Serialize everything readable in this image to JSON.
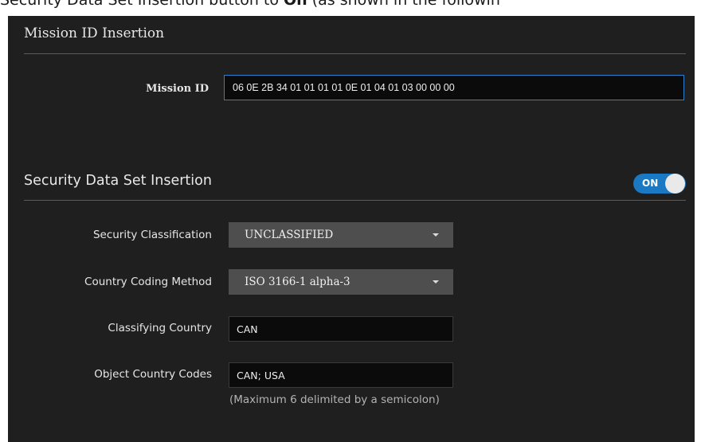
{
  "caption": {
    "prefix": "Security Data Set Insertion button to ",
    "bold": "On",
    "suffix": " (as shown in the followin"
  },
  "mission_section": {
    "title": "Mission ID Insertion",
    "mission_id_label": "Mission ID",
    "mission_id_value": "06 0E 2B 34 01 01 01 01 0E 01 04 01 03 00 00 00"
  },
  "security_section": {
    "title": "Security Data Set Insertion",
    "toggle_label": "ON",
    "security_classification_label": "Security Classification",
    "security_classification_value": "UNCLASSIFIED",
    "country_coding_method_label": "Country Coding Method",
    "country_coding_method_value": "ISO 3166-1 alpha-3",
    "classifying_country_label": "Classifying Country",
    "classifying_country_value": "CAN",
    "object_country_codes_label": "Object Country Codes",
    "object_country_codes_value": "CAN; USA",
    "object_country_codes_hint": "(Maximum 6 delimited by a semicolon)"
  },
  "colors": {
    "panel_bg": "#1f1f1f",
    "accent": "#1b78c2",
    "select_bg": "#4e4e4e"
  }
}
